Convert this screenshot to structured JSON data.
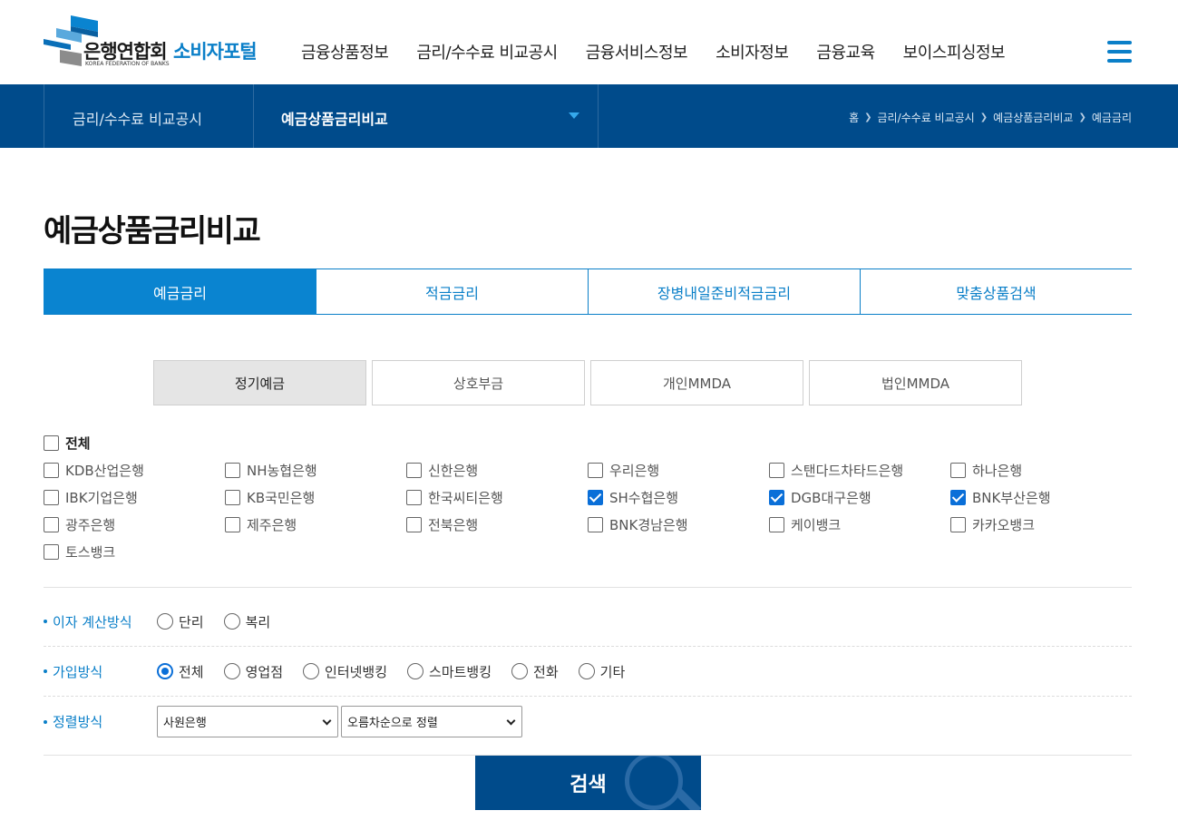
{
  "header": {
    "logo_text": "은행연합회",
    "logo_sub": "KOREA FEDERATION OF BANKS",
    "portal_name": "소비자포털",
    "nav": [
      "금융상품정보",
      "금리/수수료 비교공시",
      "금융서비스정보",
      "소비자정보",
      "금융교육",
      "보이스피싱정보"
    ],
    "menu_icon": "hamburger-icon"
  },
  "subnav": {
    "section": "금리/수수료 비교공시",
    "current": "예금상품금리비교",
    "breadcrumb": [
      "홈",
      "금리/수수료 비교공시",
      "예금상품금리비교",
      "예금금리"
    ]
  },
  "page_title": "예금상품금리비교",
  "tabs": [
    {
      "label": "예금금리",
      "active": true
    },
    {
      "label": "적금금리",
      "active": false
    },
    {
      "label": "장병내일준비적금금리",
      "active": false
    },
    {
      "label": "맞춤상품검색",
      "active": false
    }
  ],
  "subtabs": [
    {
      "label": "정기예금",
      "active": true
    },
    {
      "label": "상호부금",
      "active": false
    },
    {
      "label": "개인MMDA",
      "active": false
    },
    {
      "label": "법인MMDA",
      "active": false
    }
  ],
  "banks": {
    "all_label": "전체",
    "all_checked": false,
    "items": [
      {
        "label": "KDB산업은행",
        "checked": false
      },
      {
        "label": "NH농협은행",
        "checked": false
      },
      {
        "label": "신한은행",
        "checked": false
      },
      {
        "label": "우리은행",
        "checked": false
      },
      {
        "label": "스탠다드차타드은행",
        "checked": false
      },
      {
        "label": "하나은행",
        "checked": false
      },
      {
        "label": "IBK기업은행",
        "checked": false
      },
      {
        "label": "KB국민은행",
        "checked": false
      },
      {
        "label": "한국씨티은행",
        "checked": false
      },
      {
        "label": "SH수협은행",
        "checked": true
      },
      {
        "label": "DGB대구은행",
        "checked": true
      },
      {
        "label": "BNK부산은행",
        "checked": true
      },
      {
        "label": "광주은행",
        "checked": false
      },
      {
        "label": "제주은행",
        "checked": false
      },
      {
        "label": "전북은행",
        "checked": false
      },
      {
        "label": "BNK경남은행",
        "checked": false
      },
      {
        "label": "케이뱅크",
        "checked": false
      },
      {
        "label": "카카오뱅크",
        "checked": false
      },
      {
        "label": "토스뱅크",
        "checked": false
      }
    ]
  },
  "interest_method": {
    "label": "이자 계산방식",
    "options": [
      {
        "label": "단리",
        "selected": false
      },
      {
        "label": "복리",
        "selected": false
      }
    ]
  },
  "join_method": {
    "label": "가입방식",
    "options": [
      {
        "label": "전체",
        "selected": true
      },
      {
        "label": "영업점",
        "selected": false
      },
      {
        "label": "인터넷뱅킹",
        "selected": false
      },
      {
        "label": "스마트뱅킹",
        "selected": false
      },
      {
        "label": "전화",
        "selected": false
      },
      {
        "label": "기타",
        "selected": false
      }
    ]
  },
  "sort_method": {
    "label": "정렬방식",
    "select1": "사원은행",
    "select2": "오름차순으로 정렬"
  },
  "search_button": "검색",
  "colors": {
    "brand_blue": "#004b8b",
    "accent_blue": "#0a7fc8",
    "check_blue": "#0a6fd8"
  }
}
